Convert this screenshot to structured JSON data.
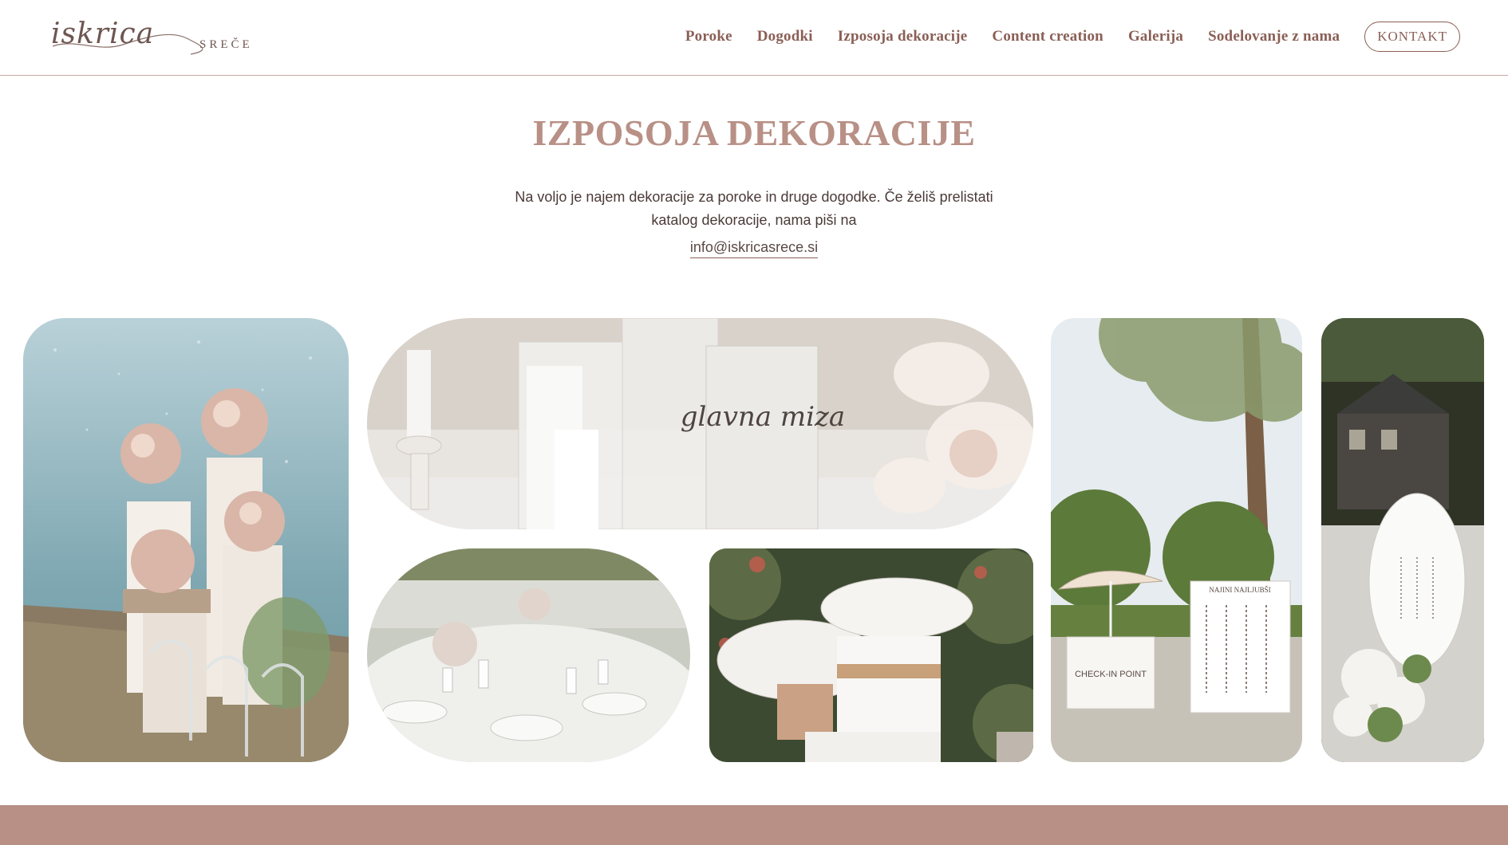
{
  "brand": {
    "logo_script": "iskrica",
    "logo_sub": "SREČE"
  },
  "nav": {
    "items": [
      {
        "label": "Poroke"
      },
      {
        "label": "Dogodki"
      },
      {
        "label": "Izposoja dekoracije"
      },
      {
        "label": "Content creation"
      },
      {
        "label": "Galerija"
      },
      {
        "label": "Sodelovanje z nama"
      }
    ],
    "contact_label": "KONTAKT"
  },
  "hero": {
    "title": "IZPOSOJA DEKORACIJE",
    "description_line1": "Na voljo je najem dekoracije za poroke in druge dogodke. Če želiš prelistati",
    "description_line2": "katalog dekoracije, nama piši na",
    "email": "info@iskricasrece.si"
  },
  "gallery": {
    "tile2_sign_text": "glavna miza",
    "tile5_sign_title": "NAJINI NAJLJUBŠI",
    "tile5_cart_text": "CHECK-IN POINT"
  },
  "colors": {
    "accent": "#b89086",
    "nav_text": "#8a5f56",
    "footer_bg": "#b89086"
  }
}
